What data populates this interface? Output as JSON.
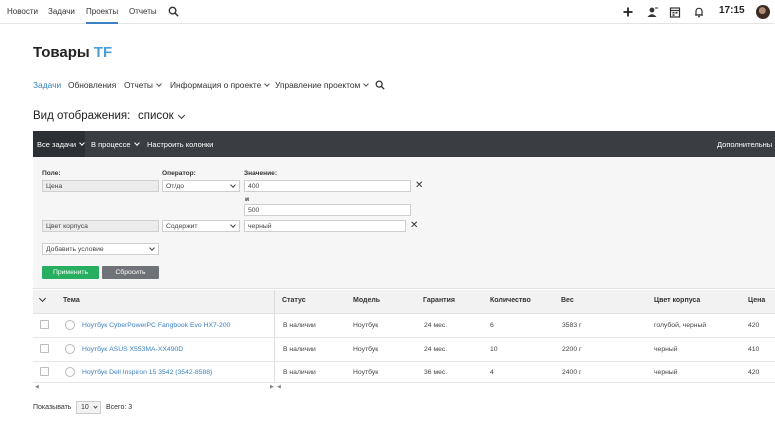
{
  "topnav": {
    "items": [
      {
        "label": "Новости"
      },
      {
        "label": "Задачи"
      },
      {
        "label": "Проекты",
        "active": true
      },
      {
        "label": "Отчеты"
      }
    ],
    "icons": [
      "search-icon",
      "plus-icon",
      "user-add-icon",
      "calendar-icon",
      "bell-icon"
    ],
    "time": "17:15"
  },
  "page": {
    "title": "Товары",
    "title_accent": "TF",
    "accent_color": "#4a9fd8"
  },
  "projnav": {
    "items": [
      {
        "label": "Задачи",
        "active": true
      },
      {
        "label": "Обновления"
      },
      {
        "label": "Отчеты"
      },
      {
        "label": "Информация о проекте"
      },
      {
        "label": "Управление проектом"
      }
    ]
  },
  "view": {
    "label": "Вид отображения:",
    "value": "список"
  },
  "toolbar": {
    "all_tasks": "Все задачи",
    "in_progress": "В процессе",
    "configure_columns": "Настроить колонки",
    "additional": "Дополнительны"
  },
  "filter": {
    "field_label": "Поле:",
    "operator_label": "Оператор:",
    "value_label": "Значение:",
    "rows": [
      {
        "field": "Цена",
        "operator": "От/до",
        "value_from": "400",
        "value_to": "500"
      },
      {
        "field": "Цвет корпуса",
        "operator": "Содержит",
        "value": "черный"
      }
    ],
    "and_label": "и",
    "add_condition": "Добавить условие",
    "apply": "Применить",
    "reset": "Сбросить",
    "apply_color": "#27ae60"
  },
  "table": {
    "columns": [
      "Тема",
      "Статус",
      "Модель",
      "Гарантия",
      "Количество",
      "Вес",
      "Цвет корпуса",
      "Цена"
    ],
    "rows": [
      {
        "title": "Ноутбук CyberPowerPC Fangbook Evo HX7-200",
        "status": "В наличии",
        "model": "Ноутбук",
        "warranty": "24 мес.",
        "qty": "6",
        "weight": "3583 г",
        "color": "голубой, черный",
        "price": "420"
      },
      {
        "title": "Ноутбук ASUS X553MA-XX490D",
        "status": "В наличии",
        "model": "Ноутбук",
        "warranty": "24 мес.",
        "qty": "10",
        "weight": "2200 г",
        "color": "черный",
        "price": "410"
      },
      {
        "title": "Ноутбук Dell Inspiron 15 3542 (3542-8588)",
        "status": "В наличии",
        "model": "Ноутбук",
        "warranty": "36 мес.",
        "qty": "4",
        "weight": "2400 г",
        "color": "черный",
        "price": "420"
      }
    ]
  },
  "footer": {
    "show_label": "Показывать",
    "page_size": "10",
    "total": "Всего: 3"
  }
}
